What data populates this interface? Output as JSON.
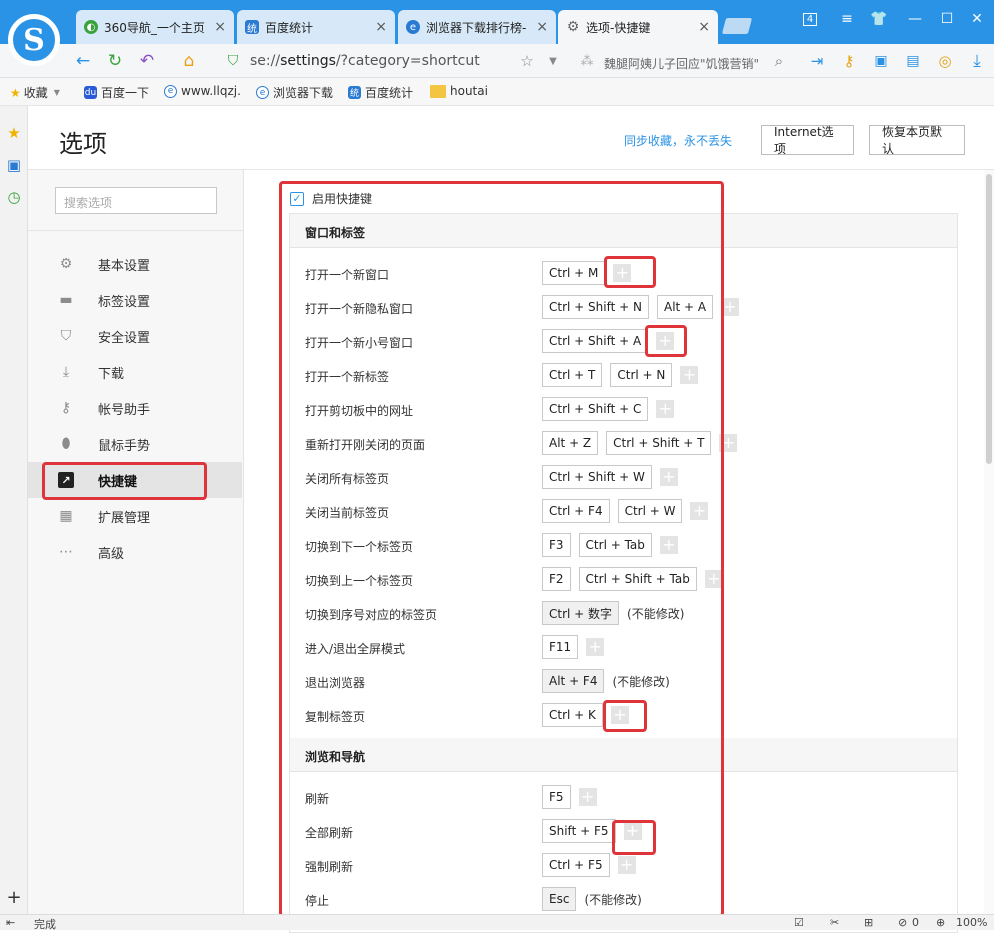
{
  "tabs": [
    {
      "label": "360导航_一个主页",
      "icon": "360-icon"
    },
    {
      "label": "百度统计",
      "icon": "baidu-tongji-icon"
    },
    {
      "label": "浏览器下载排行榜-",
      "icon": "llqzj-icon"
    },
    {
      "label": "选项-快捷键",
      "icon": "gear-icon"
    }
  ],
  "window_badge": "4",
  "address": {
    "prefix": "se://",
    "path": "settings",
    "rest": "/?category=shortcut"
  },
  "search_hint": "魏腿阿姨儿子回应\"饥饿营销\"",
  "bookmarks": [
    {
      "label": "收藏"
    },
    {
      "label": "百度一下"
    },
    {
      "label": "www.llqzj."
    },
    {
      "label": "浏览器下载"
    },
    {
      "label": "百度统计"
    },
    {
      "label": "houtai"
    }
  ],
  "header": {
    "title": "选项",
    "sync_link": "同步收藏，永不丢失",
    "internet_options": "Internet选项",
    "restore_defaults": "恢复本页默认"
  },
  "sidebar": {
    "search_placeholder": "搜索选项",
    "items": [
      {
        "label": "基本设置",
        "icon": "gear-icon"
      },
      {
        "label": "标签设置",
        "icon": "tab-icon"
      },
      {
        "label": "安全设置",
        "icon": "shield-icon"
      },
      {
        "label": "下载",
        "icon": "download-icon"
      },
      {
        "label": "帐号助手",
        "icon": "key-icon"
      },
      {
        "label": "鼠标手势",
        "icon": "mouse-icon"
      },
      {
        "label": "快捷键",
        "icon": "shortcut-icon"
      },
      {
        "label": "扩展管理",
        "icon": "extensions-icon"
      },
      {
        "label": "高级",
        "icon": "more-icon"
      }
    ],
    "active_index": 6
  },
  "shortcuts": {
    "enable_label": "启用快捷键",
    "enabled": true,
    "sections": [
      {
        "title": "窗口和标签",
        "rows": [
          {
            "label": "打开一个新窗口",
            "keys": [
              "Ctrl + M"
            ],
            "note": ""
          },
          {
            "label": "打开一个新隐私窗口",
            "keys": [
              "Ctrl + Shift + N",
              "Alt + A"
            ],
            "note": ""
          },
          {
            "label": "打开一个新小号窗口",
            "keys": [
              "Ctrl + Shift + A"
            ],
            "note": ""
          },
          {
            "label": "打开一个新标签",
            "keys": [
              "Ctrl + T",
              "Ctrl + N"
            ],
            "note": ""
          },
          {
            "label": "打开剪切板中的网址",
            "keys": [
              "Ctrl + Shift + C"
            ],
            "note": ""
          },
          {
            "label": "重新打开刚关闭的页面",
            "keys": [
              "Alt + Z",
              "Ctrl + Shift + T"
            ],
            "note": ""
          },
          {
            "label": "关闭所有标签页",
            "keys": [
              "Ctrl + Shift + W"
            ],
            "note": ""
          },
          {
            "label": "关闭当前标签页",
            "keys": [
              "Ctrl + F4",
              "Ctrl + W"
            ],
            "note": ""
          },
          {
            "label": "切换到下一个标签页",
            "keys": [
              "F3",
              "Ctrl + Tab"
            ],
            "note": ""
          },
          {
            "label": "切换到上一个标签页",
            "keys": [
              "F2",
              "Ctrl + Shift + Tab"
            ],
            "note": ""
          },
          {
            "label": "切换到序号对应的标签页",
            "keys": [
              "Ctrl + 数字"
            ],
            "note": "(不能修改)"
          },
          {
            "label": "进入/退出全屏模式",
            "keys": [
              "F11"
            ],
            "note": ""
          },
          {
            "label": "退出浏览器",
            "keys": [
              "Alt + F4"
            ],
            "note": "(不能修改)"
          },
          {
            "label": "复制标签页",
            "keys": [
              "Ctrl + K"
            ],
            "note": ""
          }
        ]
      },
      {
        "title": "浏览和导航",
        "rows": [
          {
            "label": "刷新",
            "keys": [
              "F5"
            ],
            "note": ""
          },
          {
            "label": "全部刷新",
            "keys": [
              "Shift + F5"
            ],
            "note": ""
          },
          {
            "label": "强制刷新",
            "keys": [
              "Ctrl + F5"
            ],
            "note": ""
          },
          {
            "label": "停止",
            "keys": [
              "Esc"
            ],
            "note": "(不能修改)"
          }
        ]
      }
    ]
  },
  "status": {
    "text": "完成",
    "zoom": "100%",
    "count": "0"
  },
  "colors": {
    "accent": "#2a93e6",
    "highlight": "#e0343b"
  }
}
